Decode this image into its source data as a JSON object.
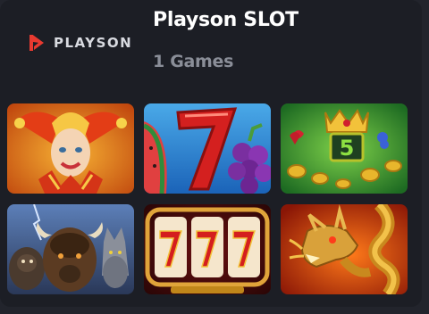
{
  "provider": {
    "logo_text": "PLAYSON",
    "title": "Playson SLOT",
    "games_count": "1 Games"
  },
  "colors": {
    "background": "#1c1e25",
    "logo_red": "#e83a30",
    "subtitle": "#8a8e98"
  },
  "games": [
    {
      "icon": "jester-icon"
    },
    {
      "icon": "lucky-seven-fruits-icon"
    },
    {
      "icon": "crown-five-icon"
    },
    {
      "icon": "buffalo-wolf-icon"
    },
    {
      "icon": "triple-seven-icon"
    },
    {
      "icon": "golden-dragon-icon"
    }
  ]
}
